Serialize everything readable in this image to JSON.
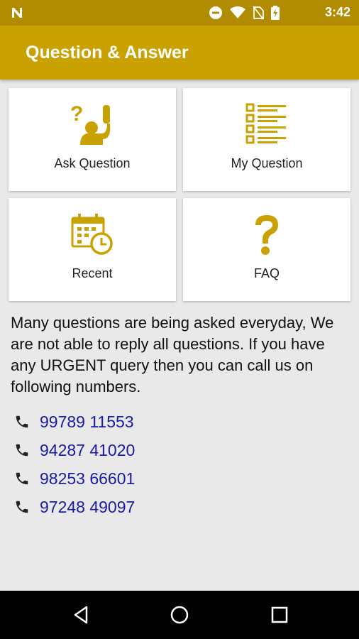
{
  "status_bar": {
    "time": "3:42",
    "icons": [
      "notification-n-icon",
      "do-not-disturb-icon",
      "wifi-icon",
      "no-sim-icon",
      "battery-charging-icon"
    ]
  },
  "app_bar": {
    "title": "Question & Answer",
    "color": "#c9a100"
  },
  "tiles": [
    {
      "label": "Ask Question",
      "icon": "ask-question-icon"
    },
    {
      "label": "My Question",
      "icon": "checklist-icon"
    },
    {
      "label": "Recent",
      "icon": "calendar-clock-icon"
    },
    {
      "label": "FAQ",
      "icon": "question-mark-icon"
    }
  ],
  "info_text": "Many questions are being asked everyday, We are not able to reply all questions. If you have any URGENT query then you can call us on following numbers.",
  "phone_numbers": [
    "99789 11553",
    "94287 41020",
    "98253 66601",
    "97248 49097"
  ],
  "nav_bar": {
    "buttons": [
      "back-icon",
      "home-icon",
      "recents-icon"
    ]
  },
  "colors": {
    "accent": "#c9a100",
    "status_bar": "#b28c00",
    "link": "#1a1aa6",
    "icon_gold": "#c9a100"
  }
}
